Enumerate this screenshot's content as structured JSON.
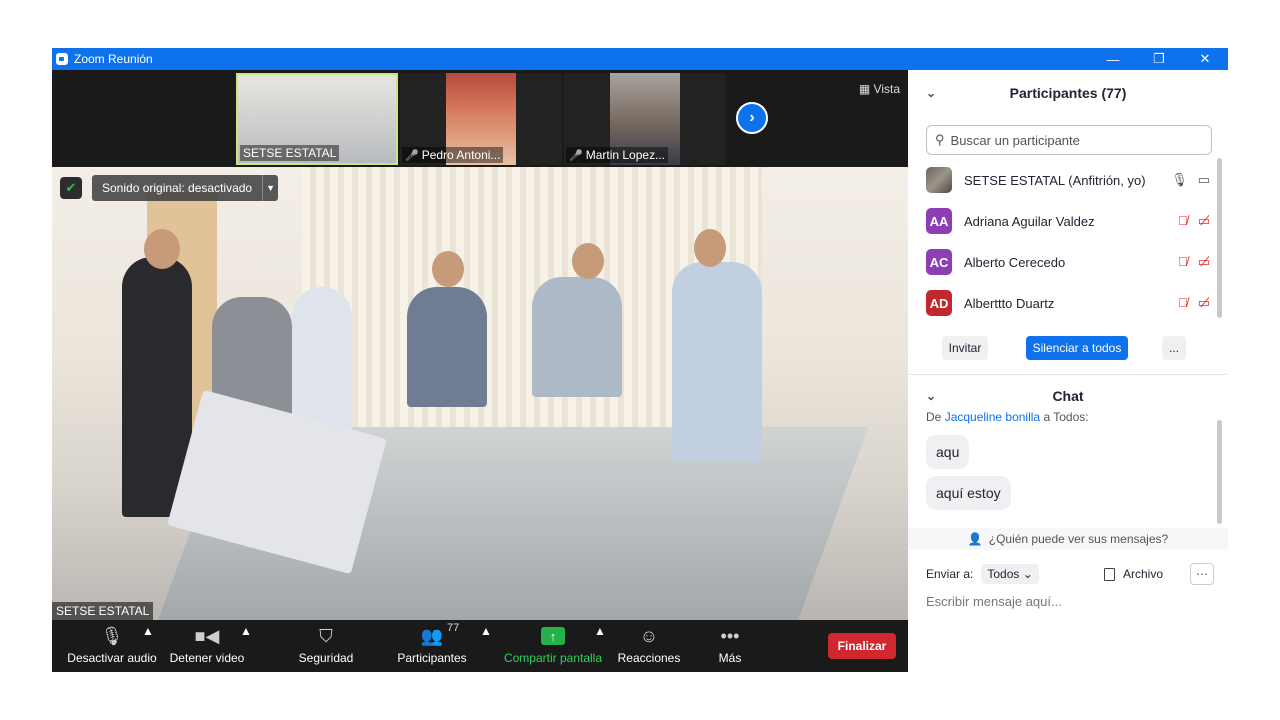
{
  "window": {
    "title": "Zoom Reunión",
    "controls": {
      "minimize": "—",
      "restore": "❐",
      "close": "✕"
    }
  },
  "thumbnails": [
    {
      "name": "SETSE ESTATAL",
      "muted": false
    },
    {
      "name": "Pedro Antoni...",
      "muted": true
    },
    {
      "name": "Martin Lopez...",
      "muted": true
    }
  ],
  "vista_label": "Vista",
  "main_video": {
    "original_sound": "Sonido original: desactivado",
    "name": "SETSE ESTATAL"
  },
  "toolbar": {
    "audio": "Desactivar audio",
    "video": "Detener video",
    "security": "Seguridad",
    "participants": "Participantes",
    "participants_count": "77",
    "share": "Compartir pantalla",
    "reactions": "Reacciones",
    "more": "Más",
    "end": "Finalizar"
  },
  "participants_panel": {
    "title": "Participantes (77)",
    "search_placeholder": "Buscar un participante",
    "list": [
      {
        "initials": "",
        "name": "SETSE ESTATAL (Anfitrión, yo)",
        "color": "",
        "muted": false
      },
      {
        "initials": "AA",
        "name": "Adriana Aguilar Valdez",
        "color": "#8c3fb3",
        "muted": true
      },
      {
        "initials": "AC",
        "name": "Alberto Cerecedo",
        "color": "#8c3fb3",
        "muted": true
      },
      {
        "initials": "AD",
        "name": "Alberttto Duartz",
        "color": "#c1272d",
        "muted": true
      }
    ],
    "invite": "Invitar",
    "mute_all": "Silenciar a todos",
    "more": "..."
  },
  "chat": {
    "title": "Chat",
    "from_prefix": "De",
    "from_name": "Jacqueline bonilla",
    "to": "a Todos:",
    "messages": [
      "aqu",
      "aquí estoy"
    ],
    "who_can_see": "¿Quién puede ver sus mensajes?",
    "send_to_label": "Enviar a:",
    "send_to_value": "Todos",
    "file_label": "Archivo",
    "input_placeholder": "Escribir mensaje aquí..."
  }
}
